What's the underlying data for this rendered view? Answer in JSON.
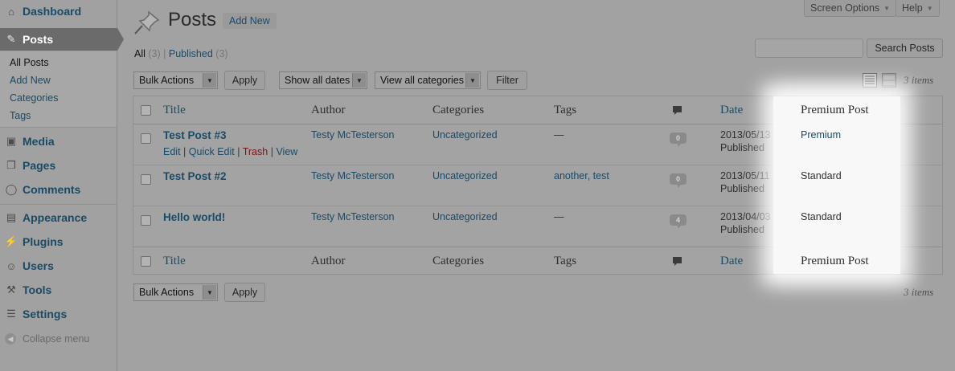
{
  "menu": {
    "dashboard": "Dashboard",
    "posts": "Posts",
    "posts_sub": [
      "All Posts",
      "Add New",
      "Categories",
      "Tags"
    ],
    "media": "Media",
    "pages": "Pages",
    "comments": "Comments",
    "appearance": "Appearance",
    "plugins": "Plugins",
    "users": "Users",
    "tools": "Tools",
    "settings": "Settings",
    "collapse": "Collapse menu"
  },
  "header": {
    "title": "Posts",
    "add_new": "Add New",
    "screen_options": "Screen Options",
    "help": "Help"
  },
  "filters": {
    "all_label": "All",
    "all_count": "(3)",
    "separator": "|",
    "published_label": "Published",
    "published_count": "(3)"
  },
  "search": {
    "value": "",
    "button": "Search Posts"
  },
  "toolbar": {
    "bulk_actions": "Bulk Actions",
    "apply": "Apply",
    "dates": "Show all dates",
    "categories": "View all categories",
    "filter": "Filter",
    "items_count": "3 items"
  },
  "table": {
    "columns": {
      "title": "Title",
      "author": "Author",
      "categories": "Categories",
      "tags": "Tags",
      "date": "Date",
      "premium": "Premium Post"
    },
    "row_actions": {
      "edit": "Edit",
      "quick_edit": "Quick Edit",
      "trash": "Trash",
      "view": "View",
      "sep": "|"
    },
    "rows": [
      {
        "title": "Test Post #3",
        "author": "Testy McTesterson",
        "categories": "Uncategorized",
        "tags": "—",
        "comments": "0",
        "date": "2013/05/13",
        "status": "Published",
        "premium": "Premium"
      },
      {
        "title": "Test Post #2",
        "author": "Testy McTesterson",
        "categories": "Uncategorized",
        "tags": "another, test",
        "comments": "0",
        "date": "2013/05/11",
        "status": "Published",
        "premium": "Standard"
      },
      {
        "title": "Hello world!",
        "author": "Testy McTesterson",
        "categories": "Uncategorized",
        "tags": "—",
        "comments": "4",
        "date": "2013/04/03",
        "status": "Published",
        "premium": "Standard"
      }
    ]
  }
}
